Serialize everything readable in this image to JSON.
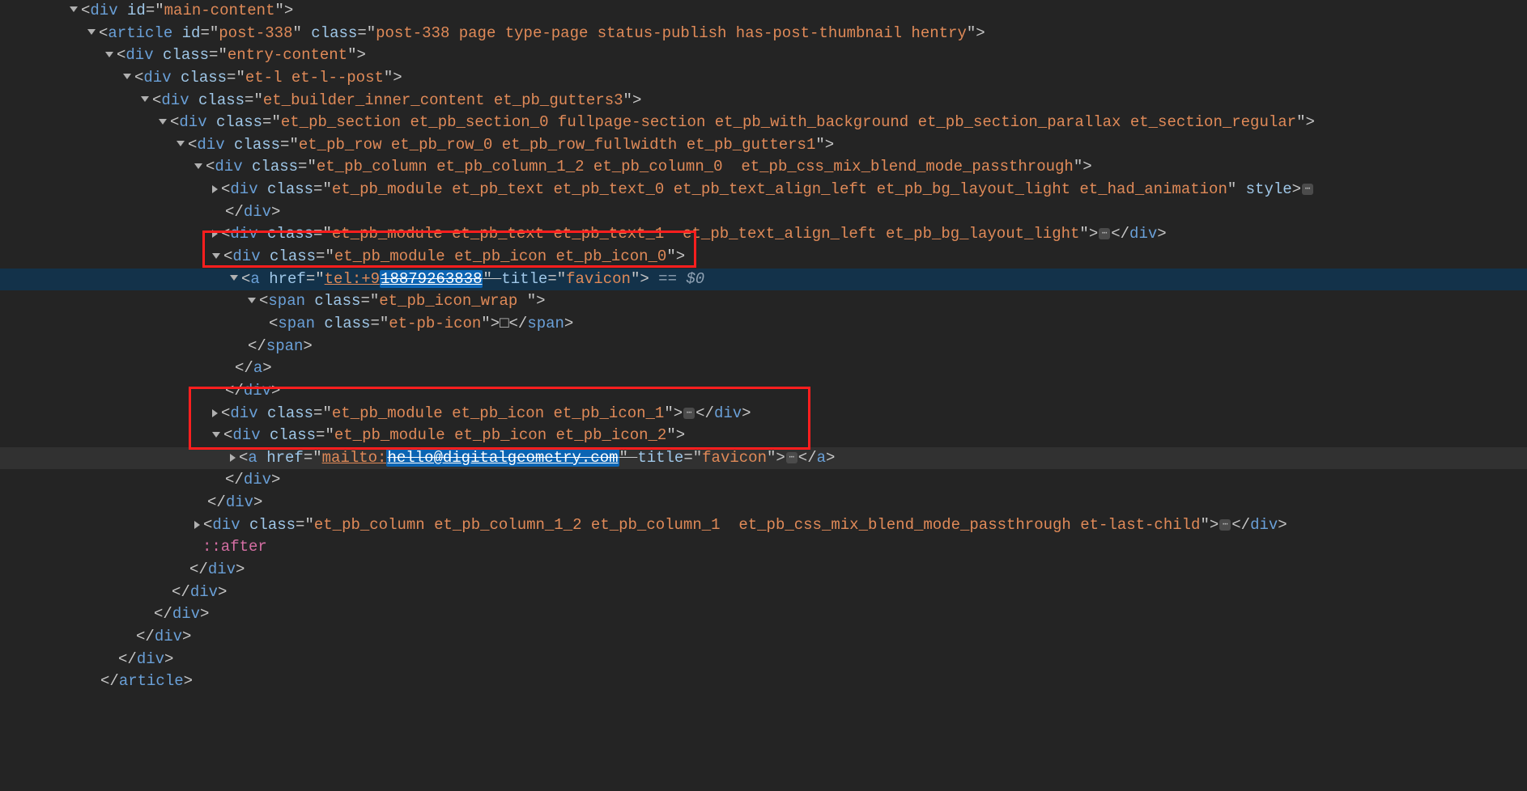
{
  "lines": [
    {
      "indent": 86,
      "caret": "down",
      "tokens": [
        [
          "punct",
          "<"
        ],
        [
          "tag",
          "div"
        ],
        [
          "punct",
          " "
        ],
        [
          "attrname",
          "id"
        ],
        [
          "eq",
          "="
        ],
        [
          "punct",
          "\""
        ],
        [
          "attrval",
          "main-content"
        ],
        [
          "punct",
          "\""
        ],
        [
          "punct",
          ">"
        ]
      ]
    },
    {
      "indent": 108,
      "caret": "down",
      "tokens": [
        [
          "punct",
          "<"
        ],
        [
          "tag",
          "article"
        ],
        [
          "punct",
          " "
        ],
        [
          "attrname",
          "id"
        ],
        [
          "eq",
          "="
        ],
        [
          "punct",
          "\""
        ],
        [
          "attrval",
          "post-338"
        ],
        [
          "punct",
          "\" "
        ],
        [
          "attrname",
          "class"
        ],
        [
          "eq",
          "="
        ],
        [
          "punct",
          "\""
        ],
        [
          "attrval",
          "post-338 page type-page status-publish has-post-thumbnail hentry"
        ],
        [
          "punct",
          "\""
        ],
        [
          "punct",
          ">"
        ]
      ]
    },
    {
      "indent": 130,
      "caret": "down",
      "tokens": [
        [
          "punct",
          "<"
        ],
        [
          "tag",
          "div"
        ],
        [
          "punct",
          " "
        ],
        [
          "attrname",
          "class"
        ],
        [
          "eq",
          "="
        ],
        [
          "punct",
          "\""
        ],
        [
          "attrval",
          "entry-content"
        ],
        [
          "punct",
          "\""
        ],
        [
          "punct",
          ">"
        ]
      ]
    },
    {
      "indent": 152,
      "caret": "down",
      "tokens": [
        [
          "punct",
          "<"
        ],
        [
          "tag",
          "div"
        ],
        [
          "punct",
          " "
        ],
        [
          "attrname",
          "class"
        ],
        [
          "eq",
          "="
        ],
        [
          "punct",
          "\""
        ],
        [
          "attrval",
          "et-l et-l--post"
        ],
        [
          "punct",
          "\""
        ],
        [
          "punct",
          ">"
        ]
      ]
    },
    {
      "indent": 174,
      "caret": "down",
      "tokens": [
        [
          "punct",
          "<"
        ],
        [
          "tag",
          "div"
        ],
        [
          "punct",
          " "
        ],
        [
          "attrname",
          "class"
        ],
        [
          "eq",
          "="
        ],
        [
          "punct",
          "\""
        ],
        [
          "attrval",
          "et_builder_inner_content et_pb_gutters3"
        ],
        [
          "punct",
          "\""
        ],
        [
          "punct",
          ">"
        ]
      ]
    },
    {
      "indent": 196,
      "caret": "down",
      "tokens": [
        [
          "punct",
          "<"
        ],
        [
          "tag",
          "div"
        ],
        [
          "punct",
          " "
        ],
        [
          "attrname",
          "class"
        ],
        [
          "eq",
          "="
        ],
        [
          "punct",
          "\""
        ],
        [
          "attrval",
          "et_pb_section et_pb_section_0 fullpage-section et_pb_with_background et_pb_section_parallax et_section_regular"
        ],
        [
          "punct",
          "\""
        ],
        [
          "punct",
          ">"
        ]
      ]
    },
    {
      "indent": 218,
      "caret": "down",
      "tokens": [
        [
          "punct",
          "<"
        ],
        [
          "tag",
          "div"
        ],
        [
          "punct",
          " "
        ],
        [
          "attrname",
          "class"
        ],
        [
          "eq",
          "="
        ],
        [
          "punct",
          "\""
        ],
        [
          "attrval",
          "et_pb_row et_pb_row_0 et_pb_row_fullwidth et_pb_gutters1"
        ],
        [
          "punct",
          "\""
        ],
        [
          "punct",
          ">"
        ]
      ]
    },
    {
      "indent": 240,
      "caret": "down",
      "tokens": [
        [
          "punct",
          "<"
        ],
        [
          "tag",
          "div"
        ],
        [
          "punct",
          " "
        ],
        [
          "attrname",
          "class"
        ],
        [
          "eq",
          "="
        ],
        [
          "punct",
          "\""
        ],
        [
          "attrval",
          "et_pb_column et_pb_column_1_2 et_pb_column_0  et_pb_css_mix_blend_mode_passthrough"
        ],
        [
          "punct",
          "\""
        ],
        [
          "punct",
          ">"
        ]
      ]
    },
    {
      "indent": 262,
      "caret": "right",
      "tokens": [
        [
          "punct",
          "<"
        ],
        [
          "tag",
          "div"
        ],
        [
          "punct",
          " "
        ],
        [
          "attrname",
          "class"
        ],
        [
          "eq",
          "="
        ],
        [
          "punct",
          "\""
        ],
        [
          "attrval",
          "et_pb_module et_pb_text et_pb_text_0 et_pb_text_align_left et_pb_bg_layout_light et_had_animation"
        ],
        [
          "punct",
          "\" "
        ],
        [
          "attrname",
          "style"
        ],
        [
          "punct",
          ">"
        ],
        [
          "ellips",
          "⋯"
        ]
      ]
    },
    {
      "indent": 278,
      "caret": null,
      "tokens": [
        [
          "punct",
          "</"
        ],
        [
          "closetag",
          "div"
        ],
        [
          "punct",
          ">"
        ]
      ]
    },
    {
      "indent": 262,
      "caret": "right",
      "tokens": [
        [
          "punct",
          "<"
        ],
        [
          "tag",
          "div"
        ],
        [
          "punct",
          " "
        ],
        [
          "attrname",
          "class"
        ],
        [
          "eq",
          "="
        ],
        [
          "punct",
          "\""
        ],
        [
          "attrval",
          "et_pb_module et_pb_text et_pb_text_1  et_pb_text_align_left et_pb_bg_layout_light"
        ],
        [
          "punct",
          "\""
        ],
        [
          "punct",
          ">"
        ],
        [
          "ellips",
          "⋯"
        ],
        [
          "punct",
          "</"
        ],
        [
          "closetag",
          "div"
        ],
        [
          "punct",
          ">"
        ]
      ]
    },
    {
      "indent": 262,
      "caret": "down",
      "tokens": [
        [
          "punct",
          "<"
        ],
        [
          "tag",
          "div"
        ],
        [
          "punct",
          " "
        ],
        [
          "attrname",
          "class"
        ],
        [
          "eq",
          "="
        ],
        [
          "punct",
          "\""
        ],
        [
          "attrval",
          "et_pb_module et_pb_icon et_pb_icon_0"
        ],
        [
          "punct",
          "\""
        ],
        [
          "punct",
          ">"
        ]
      ]
    },
    {
      "indent": 284,
      "caret": "down",
      "hl": true,
      "tokens": [
        [
          "punct",
          "<"
        ],
        [
          "tag",
          "a"
        ],
        [
          "punct",
          " "
        ],
        [
          "attrname",
          "href"
        ],
        [
          "eq",
          "="
        ],
        [
          "punct",
          "\""
        ],
        [
          "attrval_u",
          "tel:+9"
        ],
        [
          "selval_u",
          "18879263838"
        ],
        [
          "punct_strike",
          "\" "
        ],
        [
          "attrname",
          "title"
        ],
        [
          "eq",
          "="
        ],
        [
          "punct",
          "\""
        ],
        [
          "attrval",
          "favicon"
        ],
        [
          "punct",
          "\""
        ],
        [
          "punct",
          ">"
        ],
        [
          "suffix",
          " == $0"
        ]
      ]
    },
    {
      "indent": 306,
      "caret": "down",
      "tokens": [
        [
          "punct",
          "<"
        ],
        [
          "tag",
          "span"
        ],
        [
          "punct",
          " "
        ],
        [
          "attrname",
          "class"
        ],
        [
          "eq",
          "="
        ],
        [
          "punct",
          "\""
        ],
        [
          "attrval",
          "et_pb_icon_wrap "
        ],
        [
          "punct",
          "\""
        ],
        [
          "punct",
          ">"
        ]
      ]
    },
    {
      "indent": 332,
      "caret": null,
      "tokens": [
        [
          "punct",
          "<"
        ],
        [
          "tag",
          "span"
        ],
        [
          "punct",
          " "
        ],
        [
          "attrname",
          "class"
        ],
        [
          "eq",
          "="
        ],
        [
          "punct",
          "\""
        ],
        [
          "attrval",
          "et-pb-icon"
        ],
        [
          "punct",
          "\""
        ],
        [
          "punct",
          ">"
        ],
        [
          "punct",
          "□"
        ],
        [
          "punct",
          "</"
        ],
        [
          "closetag",
          "span"
        ],
        [
          "punct",
          ">"
        ]
      ]
    },
    {
      "indent": 306,
      "caret": null,
      "tokens": [
        [
          "punct",
          "</"
        ],
        [
          "closetag",
          "span"
        ],
        [
          "punct",
          ">"
        ]
      ]
    },
    {
      "indent": 290,
      "caret": null,
      "tokens": [
        [
          "punct",
          "</"
        ],
        [
          "closetag",
          "a"
        ],
        [
          "punct",
          ">"
        ]
      ]
    },
    {
      "indent": 278,
      "caret": null,
      "tokens": [
        [
          "punct",
          "</"
        ],
        [
          "closetag",
          "div"
        ],
        [
          "punct",
          ">"
        ]
      ]
    },
    {
      "indent": 262,
      "caret": "right",
      "tokens": [
        [
          "punct",
          "<"
        ],
        [
          "tag",
          "div"
        ],
        [
          "punct",
          " "
        ],
        [
          "attrname",
          "class"
        ],
        [
          "eq",
          "="
        ],
        [
          "punct",
          "\""
        ],
        [
          "attrval",
          "et_pb_module et_pb_icon et_pb_icon_1"
        ],
        [
          "punct",
          "\""
        ],
        [
          "punct",
          ">"
        ],
        [
          "ellips",
          "⋯"
        ],
        [
          "punct",
          "</"
        ],
        [
          "closetag",
          "div"
        ],
        [
          "punct",
          ">"
        ]
      ]
    },
    {
      "indent": 262,
      "caret": "down",
      "tokens": [
        [
          "punct",
          "<"
        ],
        [
          "tag",
          "div"
        ],
        [
          "punct",
          " "
        ],
        [
          "attrname",
          "class"
        ],
        [
          "eq",
          "="
        ],
        [
          "punct",
          "\""
        ],
        [
          "attrval",
          "et_pb_module et_pb_icon et_pb_icon_2"
        ],
        [
          "punct",
          "\""
        ],
        [
          "punct",
          ">"
        ]
      ]
    },
    {
      "indent": 284,
      "caret": "right",
      "hover": true,
      "tokens": [
        [
          "punct",
          "<"
        ],
        [
          "tag",
          "a"
        ],
        [
          "punct",
          " "
        ],
        [
          "attrname",
          "href"
        ],
        [
          "eq",
          "="
        ],
        [
          "punct",
          "\""
        ],
        [
          "attrval_u",
          "mailto:"
        ],
        [
          "selval_u",
          "hello@digitalgeometry.com"
        ],
        [
          "punct_strike",
          "\" "
        ],
        [
          "attrname",
          "title"
        ],
        [
          "eq",
          "="
        ],
        [
          "punct",
          "\""
        ],
        [
          "attrval",
          "favicon"
        ],
        [
          "punct",
          "\""
        ],
        [
          "punct",
          ">"
        ],
        [
          "ellips",
          "⋯"
        ],
        [
          "punct",
          "</"
        ],
        [
          "closetag",
          "a"
        ],
        [
          "punct",
          ">"
        ]
      ]
    },
    {
      "indent": 278,
      "caret": null,
      "tokens": [
        [
          "punct",
          "</"
        ],
        [
          "closetag",
          "div"
        ],
        [
          "punct",
          ">"
        ]
      ]
    },
    {
      "indent": 256,
      "caret": null,
      "tokens": [
        [
          "punct",
          "</"
        ],
        [
          "closetag",
          "div"
        ],
        [
          "punct",
          ">"
        ]
      ]
    },
    {
      "indent": 240,
      "caret": "right",
      "tokens": [
        [
          "punct",
          "<"
        ],
        [
          "tag",
          "div"
        ],
        [
          "punct",
          " "
        ],
        [
          "attrname",
          "class"
        ],
        [
          "eq",
          "="
        ],
        [
          "punct",
          "\""
        ],
        [
          "attrval",
          "et_pb_column et_pb_column_1_2 et_pb_column_1  et_pb_css_mix_blend_mode_passthrough et-last-child"
        ],
        [
          "punct",
          "\""
        ],
        [
          "punct",
          ">"
        ],
        [
          "ellips",
          "⋯"
        ],
        [
          "punct",
          "</"
        ],
        [
          "closetag",
          "div"
        ],
        [
          "punct",
          ">"
        ]
      ]
    },
    {
      "indent": 250,
      "caret": null,
      "tokens": [
        [
          "pseudo",
          "::after"
        ]
      ]
    },
    {
      "indent": 234,
      "caret": null,
      "tokens": [
        [
          "punct",
          "</"
        ],
        [
          "closetag",
          "div"
        ],
        [
          "punct",
          ">"
        ]
      ]
    },
    {
      "indent": 212,
      "caret": null,
      "tokens": [
        [
          "punct",
          "</"
        ],
        [
          "closetag",
          "div"
        ],
        [
          "punct",
          ">"
        ]
      ]
    },
    {
      "indent": 190,
      "caret": null,
      "tokens": [
        [
          "punct",
          "</"
        ],
        [
          "closetag",
          "div"
        ],
        [
          "punct",
          ">"
        ]
      ]
    },
    {
      "indent": 168,
      "caret": null,
      "tokens": [
        [
          "punct",
          "</"
        ],
        [
          "closetag",
          "div"
        ],
        [
          "punct",
          ">"
        ]
      ]
    },
    {
      "indent": 146,
      "caret": null,
      "tokens": [
        [
          "punct",
          "</"
        ],
        [
          "closetag",
          "div"
        ],
        [
          "punct",
          ">"
        ]
      ]
    },
    {
      "indent": 124,
      "caret": null,
      "tokens": [
        [
          "punct",
          "</"
        ],
        [
          "closetag",
          "article"
        ],
        [
          "punct",
          ">"
        ]
      ]
    }
  ]
}
